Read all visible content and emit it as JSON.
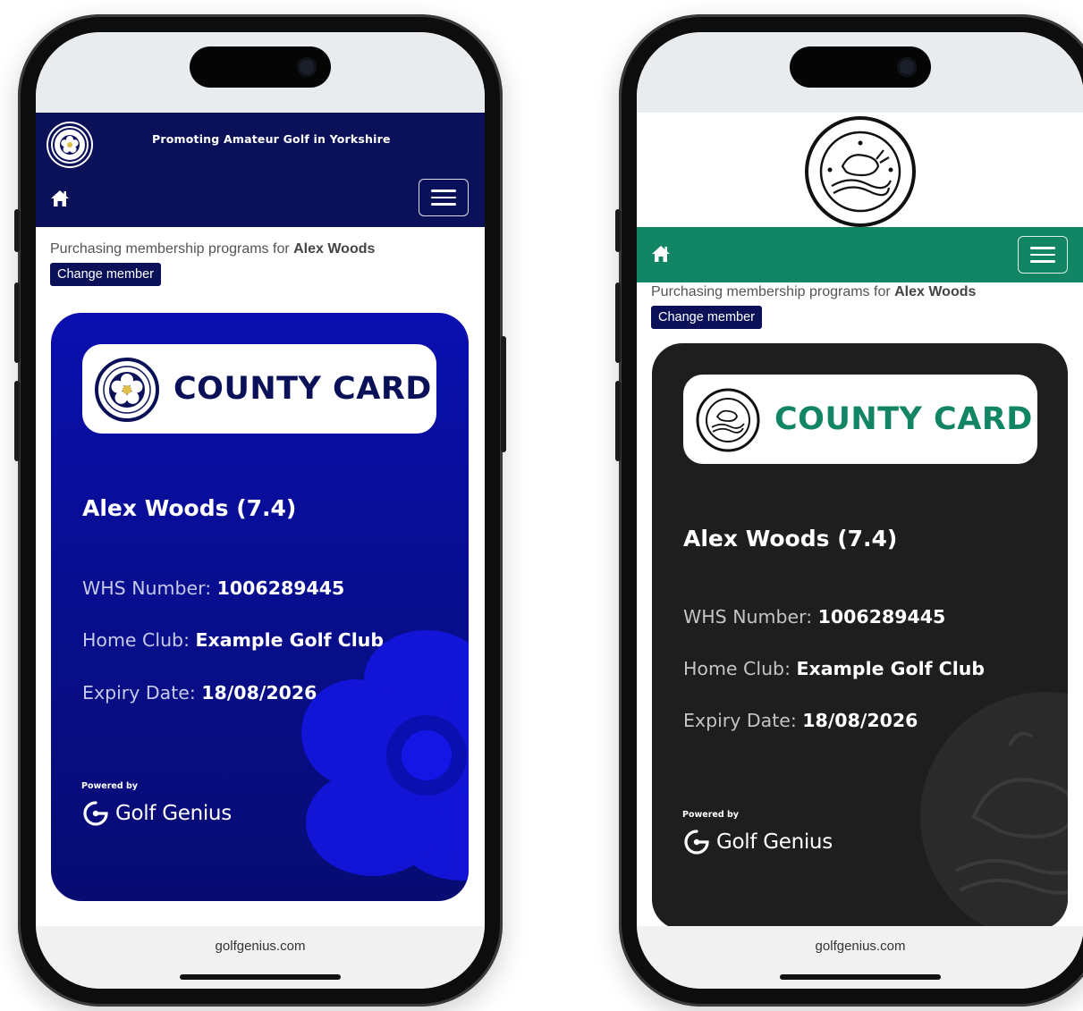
{
  "colors": {
    "navy": "#0b1158",
    "card_blue": "#0a0fb0",
    "card_dark": "#1e1e1e",
    "green": "#128564"
  },
  "left_phone": {
    "header": {
      "tagline": "Promoting Amateur  Golf in Yorkshire"
    },
    "icons": {
      "logo": "yorkshire-rose-crest-icon",
      "home": "home-icon",
      "menu": "hamburger-menu-icon"
    },
    "purchase": {
      "prefix": "Purchasing membership programs for ",
      "member": "Alex Woods",
      "change_label": "Change member"
    },
    "card": {
      "title": "COUNTY CARD",
      "name": "Alex Woods (7.4)",
      "whs_label": "WHS Number: ",
      "whs_value": "1006289445",
      "club_label": "Home Club: ",
      "club_value": "Example Golf Club",
      "expiry_label": "Expiry Date: ",
      "expiry_value": "18/08/2026",
      "powered_by": "Powered by",
      "brand": "Golf Genius"
    },
    "footer": {
      "url": "golfgenius.com"
    }
  },
  "right_phone": {
    "icons": {
      "logo": "oxfordshire-ladies-golf-crest-icon",
      "home": "home-icon",
      "menu": "hamburger-menu-icon"
    },
    "purchase": {
      "prefix": "Purchasing membership programs for ",
      "member": "Alex Woods",
      "change_label": "Change member"
    },
    "card": {
      "title": "COUNTY CARD",
      "name": "Alex Woods (7.4)",
      "whs_label": "WHS Number: ",
      "whs_value": "1006289445",
      "club_label": "Home Club: ",
      "club_value": "Example Golf Club",
      "expiry_label": "Expiry Date: ",
      "expiry_value": "18/08/2026",
      "powered_by": "Powered by",
      "brand": "Golf Genius"
    },
    "footer": {
      "url": "golfgenius.com"
    }
  }
}
